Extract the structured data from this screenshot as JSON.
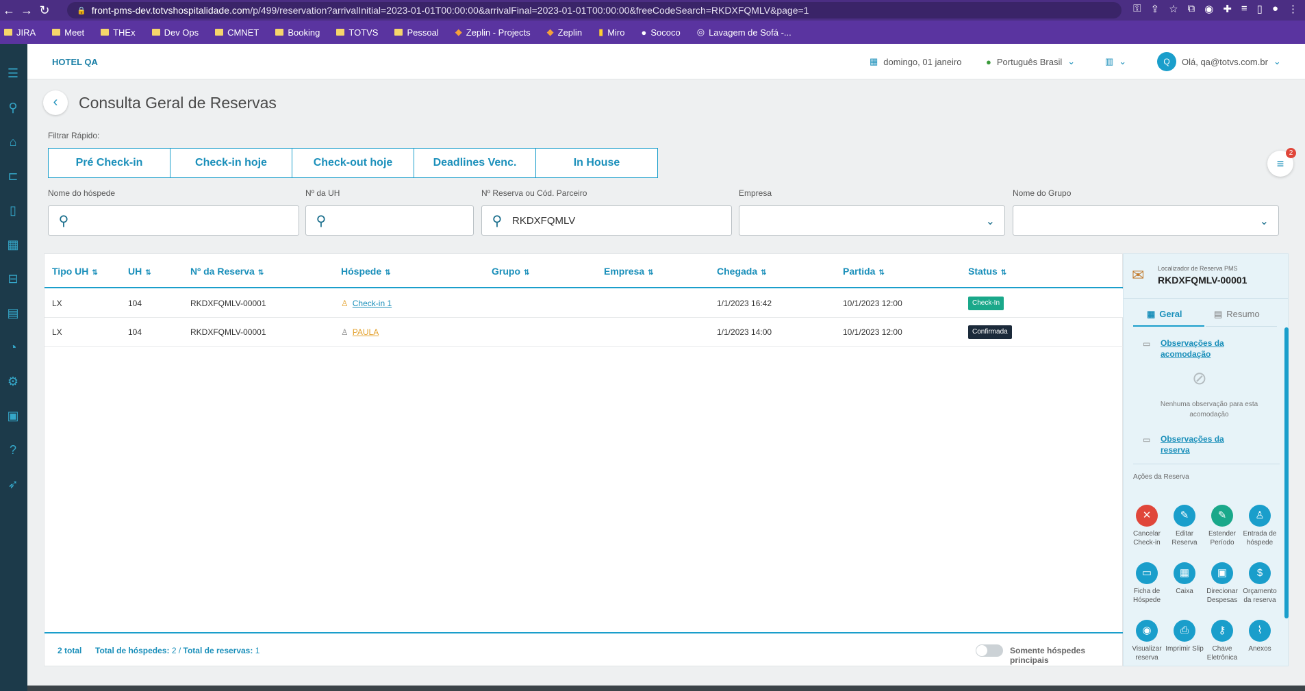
{
  "browser": {
    "url_host": "front-pms-dev.totvshospitalidade.com",
    "url_path": "/p/499/reservation?arrivalInitial=2023-01-01T00:00:00&arrivalFinal=2023-01-01T00:00:00&freeCodeSearch=RKDXFQMLV&page=1"
  },
  "bookmarks": [
    "JIRA",
    "Meet",
    "THEx",
    "Dev Ops",
    "CMNET",
    "Booking",
    "TOTVS",
    "Pessoal",
    "Zeplin - Projects",
    "Zeplin",
    "Miro",
    "Sococo",
    "Lavagem de Sofá -..."
  ],
  "header": {
    "hotel": "HOTEL QA",
    "date": "domingo, 01 janeiro",
    "language": "Português Brasil",
    "avatar_initial": "Q",
    "user": "Olá, qa@totvs.com.br"
  },
  "page": {
    "title": "Consulta Geral de Reservas",
    "quick_filter_label": "Filtrar Rápido:",
    "quick_filters": [
      "Pré Check-in",
      "Check-in hoje",
      "Check-out hoje",
      "Deadlines Venc.",
      "In House"
    ],
    "filter_badge": "2"
  },
  "filters": {
    "guest_label": "Nome do hóspede",
    "guest_value": "",
    "uh_label": "Nº da UH",
    "uh_value": "",
    "reservation_label": "Nº Reserva ou Cód. Parceiro",
    "reservation_value": "RKDXFQMLV",
    "company_label": "Empresa",
    "company_value": "",
    "group_label": "Nome do Grupo",
    "group_value": ""
  },
  "table": {
    "columns": [
      "Tipo UH",
      "UH",
      "Nº da Reserva",
      "Hóspede",
      "Grupo",
      "Empresa",
      "Chegada",
      "Partida",
      "Status"
    ],
    "rows": [
      {
        "tipo": "LX",
        "uh": "104",
        "reserva": "RKDXFQMLV-00001",
        "hospede": "Check-in 1",
        "grupo": "",
        "empresa": "",
        "chegada": "1/1/2023 16:42",
        "partida": "10/1/2023 12:00",
        "status": "Check-In"
      },
      {
        "tipo": "LX",
        "uh": "104",
        "reserva": "RKDXFQMLV-00001",
        "hospede": "PAULA",
        "grupo": "",
        "empresa": "",
        "chegada": "1/1/2023 14:00",
        "partida": "10/1/2023 12:00",
        "status": "Confirmada"
      }
    ],
    "footer": {
      "total": "2 total",
      "guests_label": "Total de hóspedes:",
      "guests_value": "2",
      "sep": "/",
      "reservations_label": "Total de reservas:",
      "reservations_value": "1",
      "toggle_label": "Somente hóspedes principais"
    }
  },
  "panel": {
    "locator_label": "Localizador de Reserva PMS",
    "locator_value": "RKDXFQMLV-00001",
    "tab_geral": "Geral",
    "tab_resumo": "Resumo",
    "obs_acomodacao": "Observações da acomodação",
    "no_obs": "Nenhuma observação para esta acomodação",
    "obs_reserva": "Observações da reserva",
    "actions_title": "Ações da Reserva",
    "actions": [
      {
        "label": "Cancelar Check-in",
        "icon": "close-icon",
        "color": "#e0463a"
      },
      {
        "label": "Editar Reserva",
        "icon": "pencil-icon",
        "color": "#1a9ecb"
      },
      {
        "label": "Estender Período",
        "icon": "pencil-icon",
        "color": "#1aa88a"
      },
      {
        "label": "Entrada de hóspede",
        "icon": "user-add-icon",
        "color": "#1a9ecb"
      },
      {
        "label": "Ficha de Hóspede",
        "icon": "folder-icon",
        "color": "#1a9ecb"
      },
      {
        "label": "Caixa",
        "icon": "calculator-icon",
        "color": "#1a9ecb"
      },
      {
        "label": "Direcionar Despesas",
        "icon": "calendar-icon",
        "color": "#1a9ecb"
      },
      {
        "label": "Orçamento da reserva",
        "icon": "dollar-icon",
        "color": "#1a9ecb"
      },
      {
        "label": "Visualizar reserva",
        "icon": "eye-icon",
        "color": "#1a9ecb"
      },
      {
        "label": "Imprimir Slip",
        "icon": "printer-icon",
        "color": "#1a9ecb"
      },
      {
        "label": "Chave Eletrônica",
        "icon": "key-icon",
        "color": "#1a9ecb"
      },
      {
        "label": "Anexos",
        "icon": "paperclip-icon",
        "color": "#1a9ecb"
      }
    ]
  },
  "colors": {
    "accent": "#1a9ecb",
    "checkin": "#1aa88a",
    "confirmed": "#1b2a3a",
    "danger": "#e0463a"
  }
}
